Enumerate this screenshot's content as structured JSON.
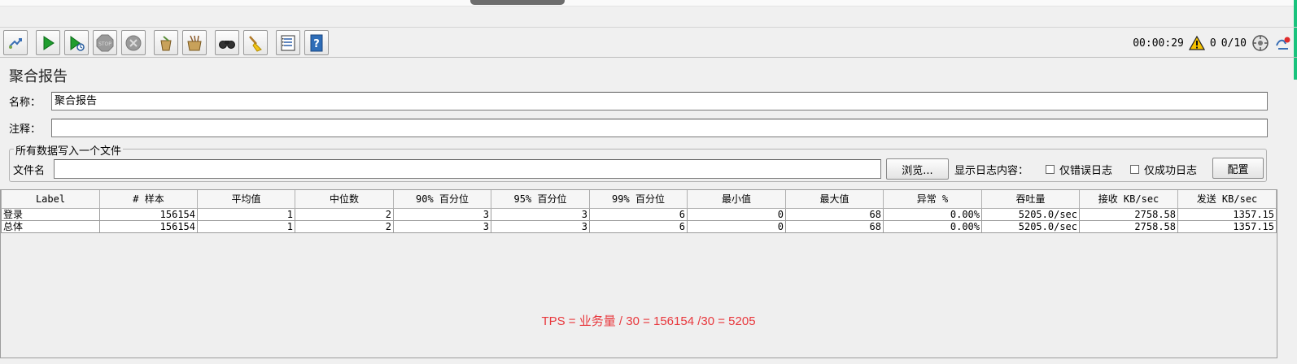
{
  "toolbar": {
    "buttons": [
      {
        "icon": "template-icon"
      },
      {
        "icon": "start-icon"
      },
      {
        "icon": "start-no-pauses-icon"
      },
      {
        "icon": "stop-icon"
      },
      {
        "icon": "shutdown-icon"
      },
      {
        "icon": "clear-icon"
      },
      {
        "icon": "clear-all-icon"
      },
      {
        "icon": "search-icon"
      },
      {
        "icon": "reset-search-icon"
      },
      {
        "icon": "function-helper-icon"
      },
      {
        "icon": "help-icon"
      }
    ],
    "timer": "00:00:29",
    "warning_count": "0",
    "threads": "0/10"
  },
  "panel": {
    "title": "聚合报告",
    "name_label": "名称：",
    "name_value": "聚合报告",
    "comment_label": "注释：",
    "comment_value": "",
    "write_all_legend": "所有数据写入一个文件",
    "filename_label": "文件名",
    "filename_value": "",
    "browse_button": "浏览...",
    "log_content_label": "显示日志内容：",
    "errors_only_label": "仅错误日志",
    "success_only_label": "仅成功日志",
    "configure_button": "配置"
  },
  "table": {
    "headers": [
      "Label",
      "# 样本",
      "平均值",
      "中位数",
      "90% 百分位",
      "95% 百分位",
      "99% 百分位",
      "最小值",
      "最大值",
      "异常 %",
      "吞吐量",
      "接收 KB/sec",
      "发送 KB/sec"
    ],
    "rows": [
      [
        "登录",
        "156154",
        "1",
        "2",
        "3",
        "3",
        "6",
        "0",
        "68",
        "0.00%",
        "5205.0/sec",
        "2758.58",
        "1357.15"
      ],
      [
        "总体",
        "156154",
        "1",
        "2",
        "3",
        "3",
        "6",
        "0",
        "68",
        "0.00%",
        "5205.0/sec",
        "2758.58",
        "1357.15"
      ]
    ]
  },
  "annotation": "TPS =  业务量  /  30   = 156154 /30 = 5205",
  "colors": {
    "annotation": "#e8383d",
    "accent_bar": "#19c37d"
  }
}
